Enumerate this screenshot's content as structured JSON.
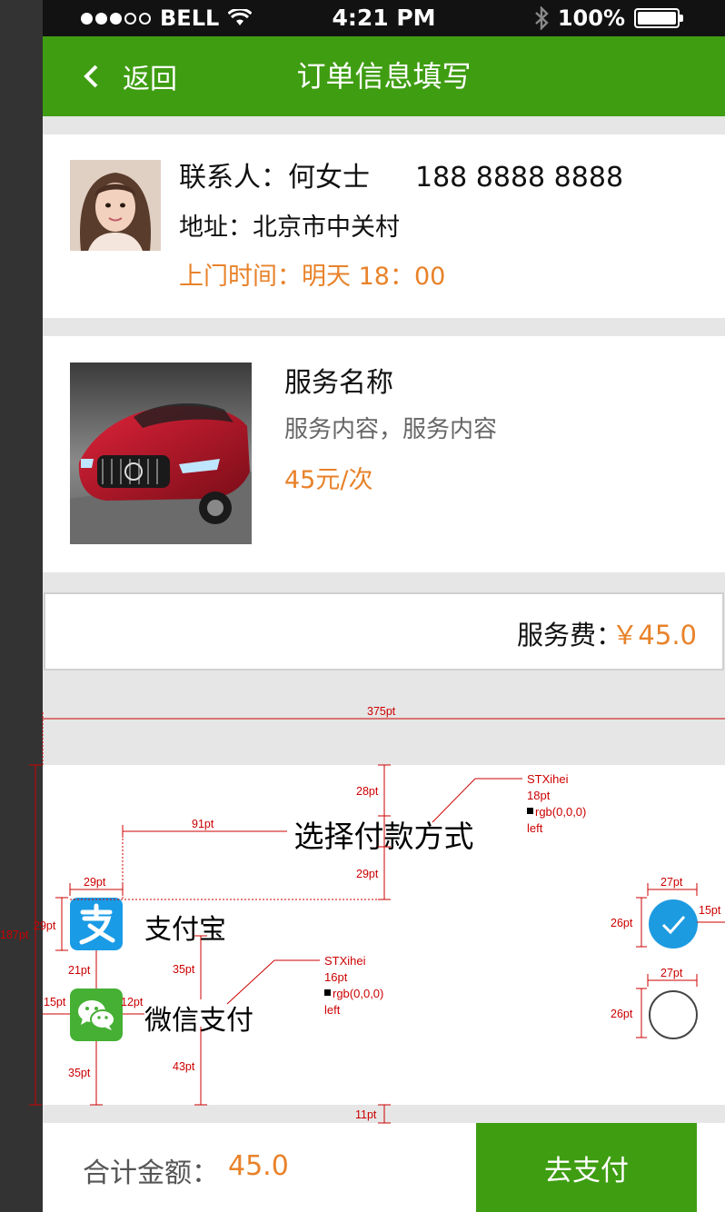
{
  "status_bar": {
    "carrier": "BELL",
    "time": "4:21 PM",
    "battery": "100%"
  },
  "nav": {
    "back_label": "返回",
    "title": "订单信息填写"
  },
  "contact": {
    "name_label": "联系人：何女士",
    "phone": "188 8888 8888",
    "address": "地址：北京市中关村",
    "visit_time": "上门时间：明天 18：00"
  },
  "service": {
    "name": "服务名称",
    "description": "服务内容，服务内容",
    "price": "45元/次"
  },
  "fee": {
    "label": "服务费：",
    "amount": "￥45.0"
  },
  "payment": {
    "heading": "选择付款方式",
    "options": [
      {
        "label": "支付宝",
        "selected": true
      },
      {
        "label": "微信支付",
        "selected": false
      }
    ]
  },
  "footer": {
    "total_label": "合计金额：",
    "total_value": "45.0",
    "pay_button": "去支付"
  },
  "annotations": {
    "width_total": "375pt",
    "heading_top": "28pt",
    "heading_bottom": "29pt",
    "heading_left": "91pt",
    "icon_left": "29pt",
    "icon_height": "29pt",
    "section_height": "187pt",
    "icon_gap": "21pt",
    "row_left": "15pt",
    "label_gap": "12pt",
    "icon_bottom": "35pt",
    "label_spacing": "35pt",
    "label_bottom": "43pt",
    "radio_width_1": "27pt",
    "radio_width_2": "27pt",
    "radio_height_1": "26pt",
    "radio_height_2": "26pt",
    "radio_right": "15pt",
    "bottom_gap": "11pt",
    "heading_spec": [
      "STXihei",
      "18pt",
      "rgb(0,0,0)",
      "left"
    ],
    "label_spec": [
      "STXihei",
      "16pt",
      "rgb(0,0,0)",
      "left"
    ]
  },
  "colors": {
    "brand_green": "#3f9d12",
    "accent_orange": "#e8822a",
    "radio_blue": "#1d9be0",
    "annotation_red": "#cc0000"
  }
}
